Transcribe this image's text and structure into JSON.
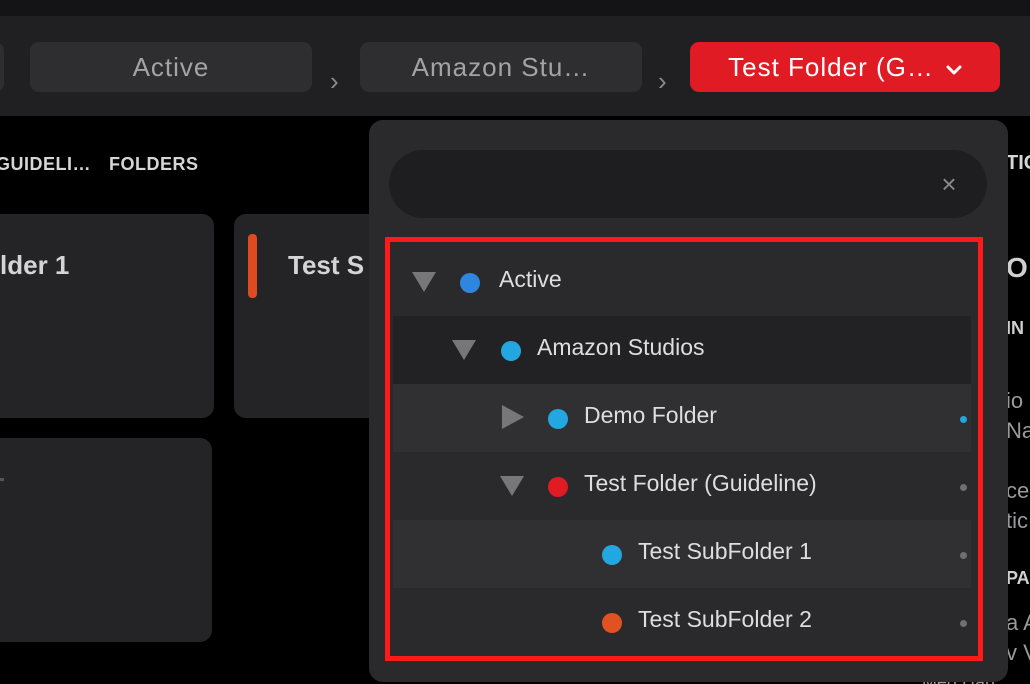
{
  "breadcrumb": {
    "items": [
      {
        "label": "Active"
      },
      {
        "label": "Amazon Stu…"
      },
      {
        "label": "Test Folder (G…"
      }
    ],
    "separator": "›",
    "current_chevron": "⌄"
  },
  "tabs": [
    {
      "label": "GUIDELI…"
    },
    {
      "label": "FOLDERS"
    }
  ],
  "cards": [
    {
      "title": "lder 1"
    },
    {
      "title": "Test S"
    }
  ],
  "dropdown": {
    "search": {
      "value": "",
      "placeholder": ""
    },
    "clear_glyph": "×",
    "tree": [
      {
        "label": "Active",
        "expanded": true,
        "dot_color": "#2e86de"
      },
      {
        "label": "Amazon Studios",
        "expanded": true,
        "dot_color": "#22a7e0"
      },
      {
        "label": "Demo Folder",
        "expanded": false,
        "dot_color": "#22a7e0"
      },
      {
        "label": "Test Folder (Guideline)",
        "expanded": true,
        "dot_color": "#e01b24"
      },
      {
        "label": "Test SubFolder 1",
        "dot_color": "#22a7e0"
      },
      {
        "label": "Test SubFolder 2",
        "dot_color": "#e0521f"
      }
    ]
  },
  "right_column": {
    "fragments": [
      "TIC",
      "O",
      "IN",
      "io",
      "Na",
      "ce",
      "tic",
      "PA",
      "a A",
      "v V"
    ]
  },
  "bottom_text": "Meg Harr",
  "colors": {
    "accent": "#e01b24",
    "highlight_box": "#ff1a1a",
    "background": "#000000"
  }
}
